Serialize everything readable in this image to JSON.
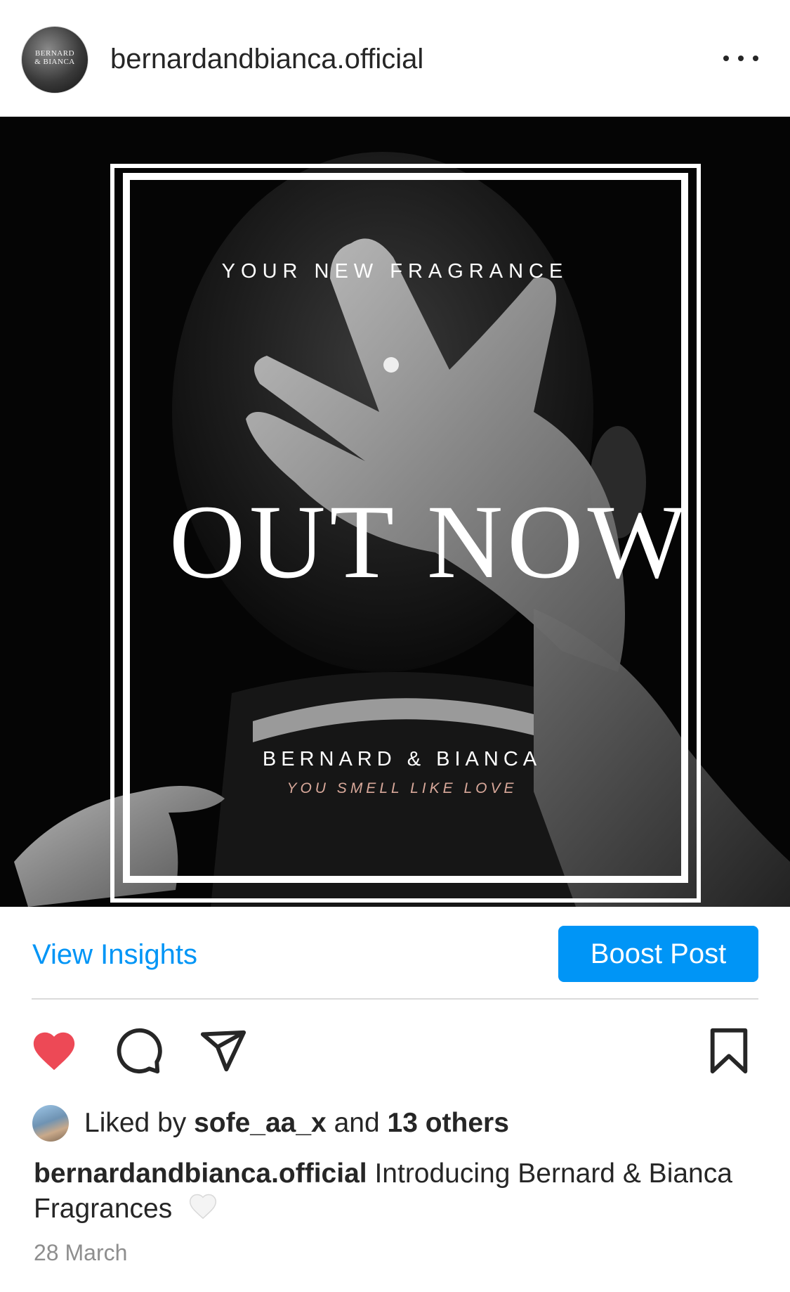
{
  "header": {
    "username": "bernardandbianca.official",
    "avatar_logo_line1": "BERNARD",
    "avatar_logo_line2": "& BIANCA",
    "more_icon": "more-horizontal-icon"
  },
  "post_image": {
    "kicker": "YOUR NEW FRAGRANCE",
    "headline": "OUT NOW",
    "brand": "BERNARD & BIANCA",
    "tagline": "YOU SMELL LIKE LOVE"
  },
  "insights": {
    "view_insights_label": "View Insights",
    "boost_label": "Boost Post"
  },
  "actions": {
    "like_icon": "heart-filled-icon",
    "comment_icon": "comment-icon",
    "share_icon": "send-icon",
    "save_icon": "bookmark-icon",
    "like_color": "#ed4956"
  },
  "likes": {
    "prefix": "Liked by",
    "liker": "sofe_aa_x",
    "joiner": "and",
    "others": "13 others"
  },
  "caption": {
    "username": "bernardandbianca.official",
    "text": "Introducing Bernard & Bianca Fragrances",
    "emoji": "🤍"
  },
  "date": "28 March",
  "colors": {
    "accent": "#0095f6",
    "text": "#262626",
    "muted": "#8e8e8e",
    "tagline": "#d8a89a"
  }
}
